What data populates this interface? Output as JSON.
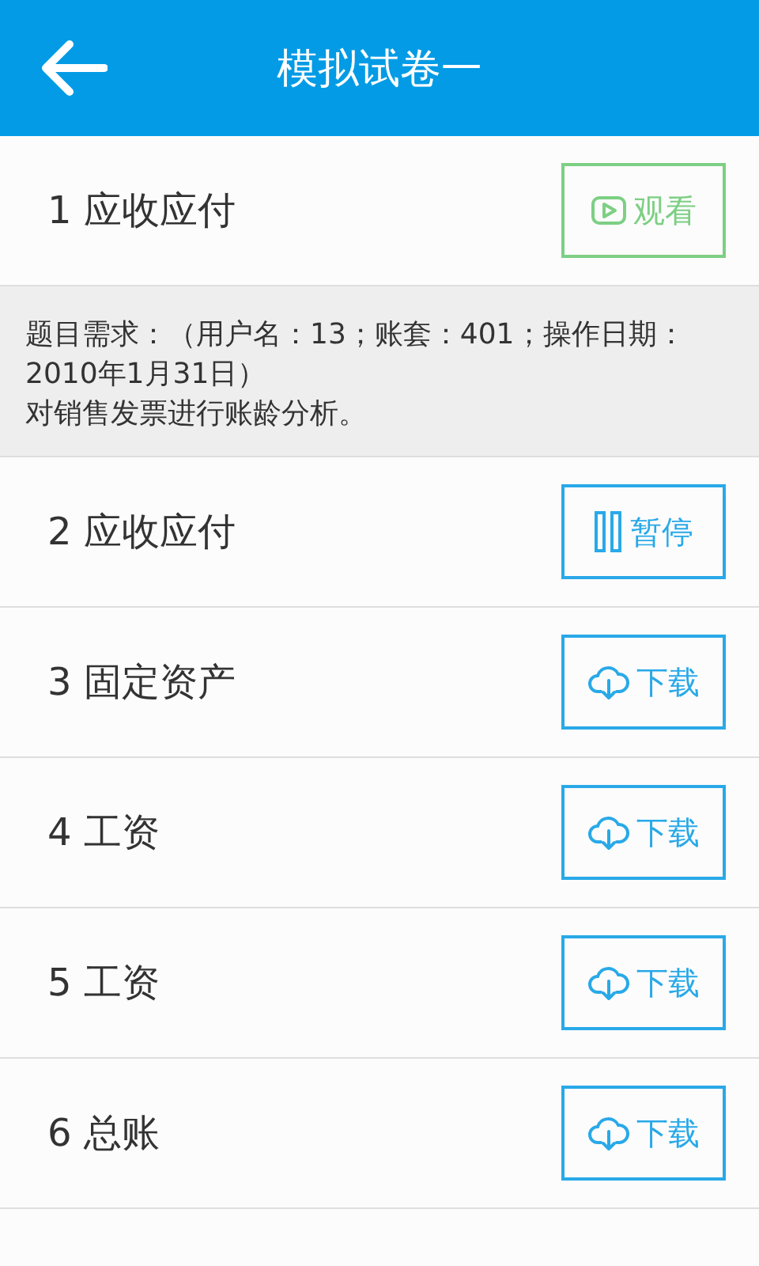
{
  "header": {
    "title": "模拟试卷一"
  },
  "items": [
    {
      "title": "1 应收应付",
      "kind": "watch",
      "button": "观看",
      "description": [
        "题目需求：（用户名：13；账套：401；操作日期：2010年1月31日）",
        "对销售发票进行账龄分析。"
      ]
    },
    {
      "title": "2 应收应付",
      "kind": "pause",
      "button": "暂停"
    },
    {
      "title": "3 固定资产",
      "kind": "download",
      "button": "下载"
    },
    {
      "title": "4 工资",
      "kind": "download",
      "button": "下载"
    },
    {
      "title": "5 工资",
      "kind": "download",
      "button": "下载"
    },
    {
      "title": "6 总账",
      "kind": "download",
      "button": "下载"
    }
  ]
}
